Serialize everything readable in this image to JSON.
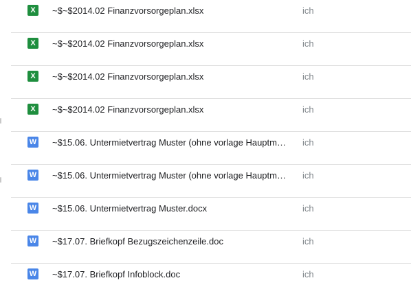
{
  "colors": {
    "excel_icon": "#1e8e3e",
    "word_icon": "#4a86e8",
    "divider": "#e0e0e0",
    "owner_text": "#80868b",
    "name_text": "#202124"
  },
  "files": [
    {
      "icon": "excel-icon",
      "glyph": "X",
      "name": "~$~$2014.02 Finanzvorsorgeplan.xlsx",
      "owner": "ich"
    },
    {
      "icon": "excel-icon",
      "glyph": "X",
      "name": "~$~$2014.02 Finanzvorsorgeplan.xlsx",
      "owner": "ich"
    },
    {
      "icon": "excel-icon",
      "glyph": "X",
      "name": "~$~$2014.02 Finanzvorsorgeplan.xlsx",
      "owner": "ich"
    },
    {
      "icon": "excel-icon",
      "glyph": "X",
      "name": "~$~$2014.02 Finanzvorsorgeplan.xlsx",
      "owner": "ich"
    },
    {
      "icon": "word-icon",
      "glyph": "W",
      "name": "~$15.06. Untermietvertrag Muster (ohne vorlage Hauptm…",
      "owner": "ich"
    },
    {
      "icon": "word-icon",
      "glyph": "W",
      "name": "~$15.06. Untermietvertrag Muster (ohne vorlage Hauptm…",
      "owner": "ich"
    },
    {
      "icon": "word-icon",
      "glyph": "W",
      "name": "~$15.06. Untermietvertrag Muster.docx",
      "owner": "ich"
    },
    {
      "icon": "word-icon",
      "glyph": "W",
      "name": "~$17.07. Briefkopf Bezugszeichenzeile.doc",
      "owner": "ich"
    },
    {
      "icon": "word-icon",
      "glyph": "W",
      "name": "~$17.07. Briefkopf Infoblock.doc",
      "owner": "ich"
    }
  ]
}
